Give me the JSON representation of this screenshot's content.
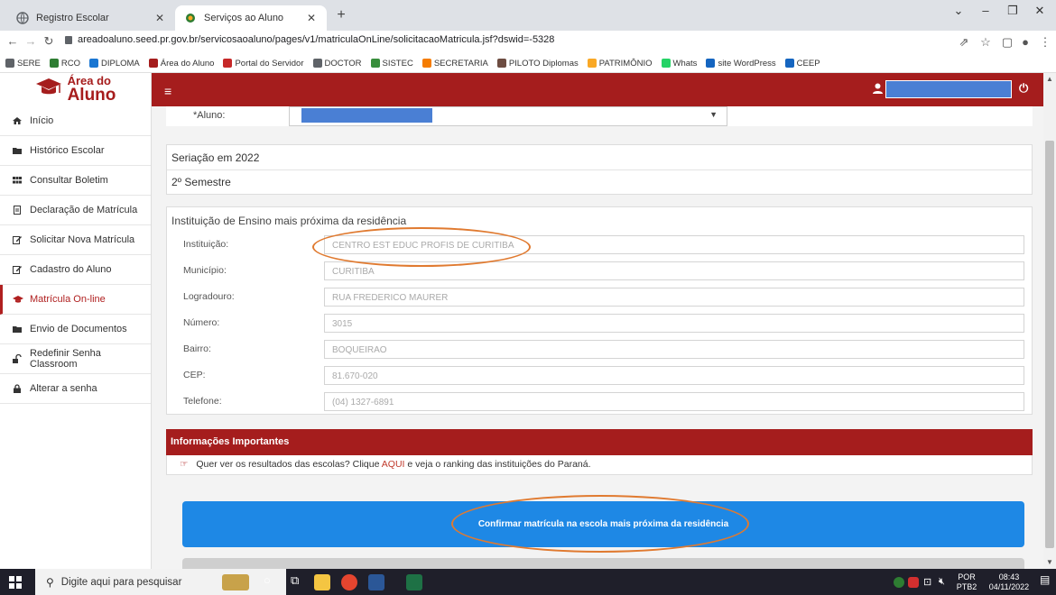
{
  "browser": {
    "tabs": [
      {
        "title": "Registro Escolar",
        "active": false
      },
      {
        "title": "Serviços ao Aluno",
        "active": true
      }
    ],
    "url": "areadoaluno.seed.pr.gov.br/servicosaoaluno/pages/v1/matriculaOnLine/solicitacaoMatricula.jsf?dswid=-5328",
    "bookmarks": [
      {
        "label": "SERE",
        "color": "#5f6368"
      },
      {
        "label": "RCO",
        "color": "#2e7d32"
      },
      {
        "label": "DIPLOMA",
        "color": "#1976d2"
      },
      {
        "label": "Área do Aluno",
        "color": "#a51d1d"
      },
      {
        "label": "Portal do Servidor",
        "color": "#c62828"
      },
      {
        "label": "DOCTOR",
        "color": "#5f6368"
      },
      {
        "label": "SISTEC",
        "color": "#388e3c"
      },
      {
        "label": "SECRETARIA",
        "color": "#f57c00"
      },
      {
        "label": "PILOTO Diplomas",
        "color": "#6d4c41"
      },
      {
        "label": "PATRIMÔNIO",
        "color": "#f9a825"
      },
      {
        "label": "Whats",
        "color": "#25d366"
      },
      {
        "label": "site WordPress",
        "color": "#1565c0"
      },
      {
        "label": "CEEP",
        "color": "#1565c0"
      }
    ]
  },
  "header": {
    "logo_line1": "Área do",
    "logo_line2": "Aluno"
  },
  "sidebar": {
    "items": [
      {
        "label": "Início",
        "icon": "home-icon",
        "active": false
      },
      {
        "label": "Histórico Escolar",
        "icon": "folder-icon",
        "active": false
      },
      {
        "label": "Consultar Boletim",
        "icon": "grid-icon",
        "active": false
      },
      {
        "label": "Declaração de Matrícula",
        "icon": "document-icon",
        "active": false
      },
      {
        "label": "Solicitar Nova Matrícula",
        "icon": "edit-icon",
        "active": false
      },
      {
        "label": "Cadastro do Aluno",
        "icon": "edit-icon",
        "active": false
      },
      {
        "label": "Matrícula On-line",
        "icon": "graduation-cap-icon",
        "active": true
      },
      {
        "label": "Envio de Documentos",
        "icon": "folder-icon",
        "active": false
      },
      {
        "label": "Redefinir Senha Classroom",
        "icon": "unlock-icon",
        "active": false
      },
      {
        "label": "Alterar a senha",
        "icon": "lock-icon",
        "active": false
      }
    ]
  },
  "main": {
    "aluno_label": "*Aluno:",
    "seriacao_title": "Seriação em 2022",
    "seriacao_value": "2º Semestre",
    "instituicao_title": "Instituição de Ensino mais próxima da residência",
    "fields": [
      {
        "label": "Instituição:",
        "value": "CENTRO EST EDUC PROFIS DE CURITIBA"
      },
      {
        "label": "Município:",
        "value": "CURITIBA"
      },
      {
        "label": "Logradouro:",
        "value": "RUA FREDERICO MAURER"
      },
      {
        "label": "Número:",
        "value": "3015"
      },
      {
        "label": "Bairro:",
        "value": "BOQUEIRAO"
      },
      {
        "label": "CEP:",
        "value": "81.670-020"
      },
      {
        "label": "Telefone:",
        "value": "(04) 1327-6891"
      }
    ],
    "info_title": "Informações Importantes",
    "info_text_before": "Quer ver os resultados das escolas? Clique",
    "info_link": "AQUI",
    "info_text_after": "e veja o ranking das instituições do Paraná.",
    "confirm_label": "Confirmar matrícula na escola mais próxima da residência"
  },
  "taskbar": {
    "search_placeholder": "Digite aqui para pesquisar",
    "lang_line1": "POR",
    "lang_line2": "PTB2",
    "time": "08:43",
    "date": "04/11/2022"
  },
  "colors": {
    "brand_red": "#a51d1d",
    "confirm_blue": "#1e88e5",
    "highlight_orange": "#e07a30"
  }
}
